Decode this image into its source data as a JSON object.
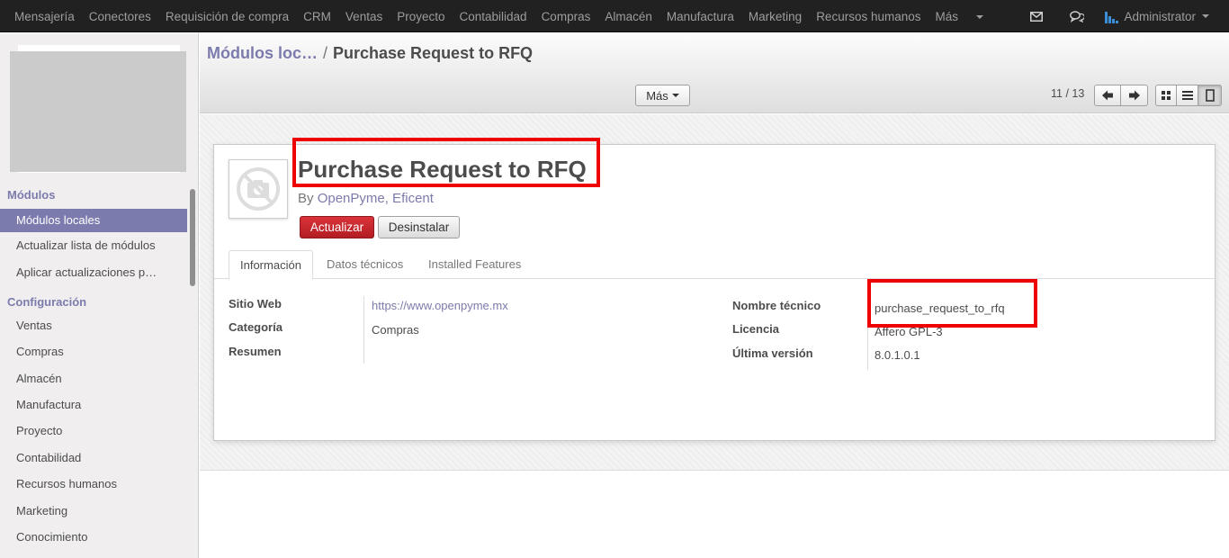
{
  "topmenu": [
    "Mensajería",
    "Conectores",
    "Requisición de compra",
    "CRM",
    "Ventas",
    "Proyecto",
    "Contabilidad",
    "Compras",
    "Almacén",
    "Manufactura",
    "Marketing",
    "Recursos humanos",
    "Más"
  ],
  "user": {
    "name": "Administrator"
  },
  "sidebar": {
    "section1": "Módulos",
    "items1": [
      "Módulos locales",
      "Actualizar lista de módulos",
      "Aplicar actualizaciones p…"
    ],
    "section2": "Configuración",
    "items2": [
      "Ventas",
      "Compras",
      "Almacén",
      "Manufactura",
      "Proyecto",
      "Contabilidad",
      "Recursos humanos",
      "Marketing",
      "Conocimiento"
    ]
  },
  "breadcrumb": {
    "parent": "Módulos loc…",
    "separator": "/",
    "current": "Purchase Request to RFQ"
  },
  "toolbar": {
    "more_label": "Más",
    "pager": "11 / 13"
  },
  "module": {
    "title": "Purchase Request to RFQ",
    "by_prefix": "By",
    "authors": "OpenPyme, Eficent",
    "update_button": "Actualizar",
    "uninstall_button": "Desinstalar"
  },
  "tabs": [
    "Información",
    "Datos técnicos",
    "Installed Features"
  ],
  "info": {
    "website_label": "Sitio Web",
    "website_value": "https://www.openpyme.mx",
    "category_label": "Categoría",
    "category_value": "Compras",
    "summary_label": "Resumen",
    "tech_name_label": "Nombre técnico",
    "tech_name_value": "purchase_request_to_rfq",
    "license_label": "Licencia",
    "license_value": "Affero GPL-3",
    "version_label": "Última versión",
    "version_value": "8.0.1.0.1"
  },
  "colors": {
    "accent": "#7c7bad",
    "primary_button": "#c62828",
    "highlight": "#ee0000",
    "topbar": "#212121"
  }
}
